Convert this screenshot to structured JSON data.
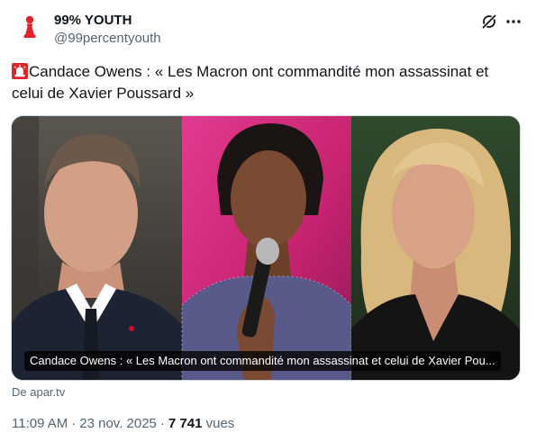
{
  "author": {
    "display_name": "99% YOUTH",
    "handle": "@99percentyouth",
    "avatar_icon": "red-chess-pawn-icon"
  },
  "header_actions": {
    "grok_icon": "grok-icon",
    "more_icon": "more-horizontal-icon"
  },
  "tweet": {
    "emoji_icon": "rotating-light-siren-icon",
    "text": "Candace Owens : « Les Macron ont commandité mon assassinat et celui de Xavier Poussard »"
  },
  "card": {
    "caption": "Candace Owens : « Les Macron ont commandité mon assassinat et celui de Xavier Pou...",
    "source": "De apar.tv"
  },
  "meta": {
    "time": "11:09 AM",
    "separator": "·",
    "date": "23 nov. 2025",
    "views_count": "7 741",
    "views_label": "vues"
  },
  "colors": {
    "text_primary": "#0f1419",
    "text_secondary": "#536471",
    "avatar_red": "#e0242b",
    "border": "#cfd9de"
  }
}
